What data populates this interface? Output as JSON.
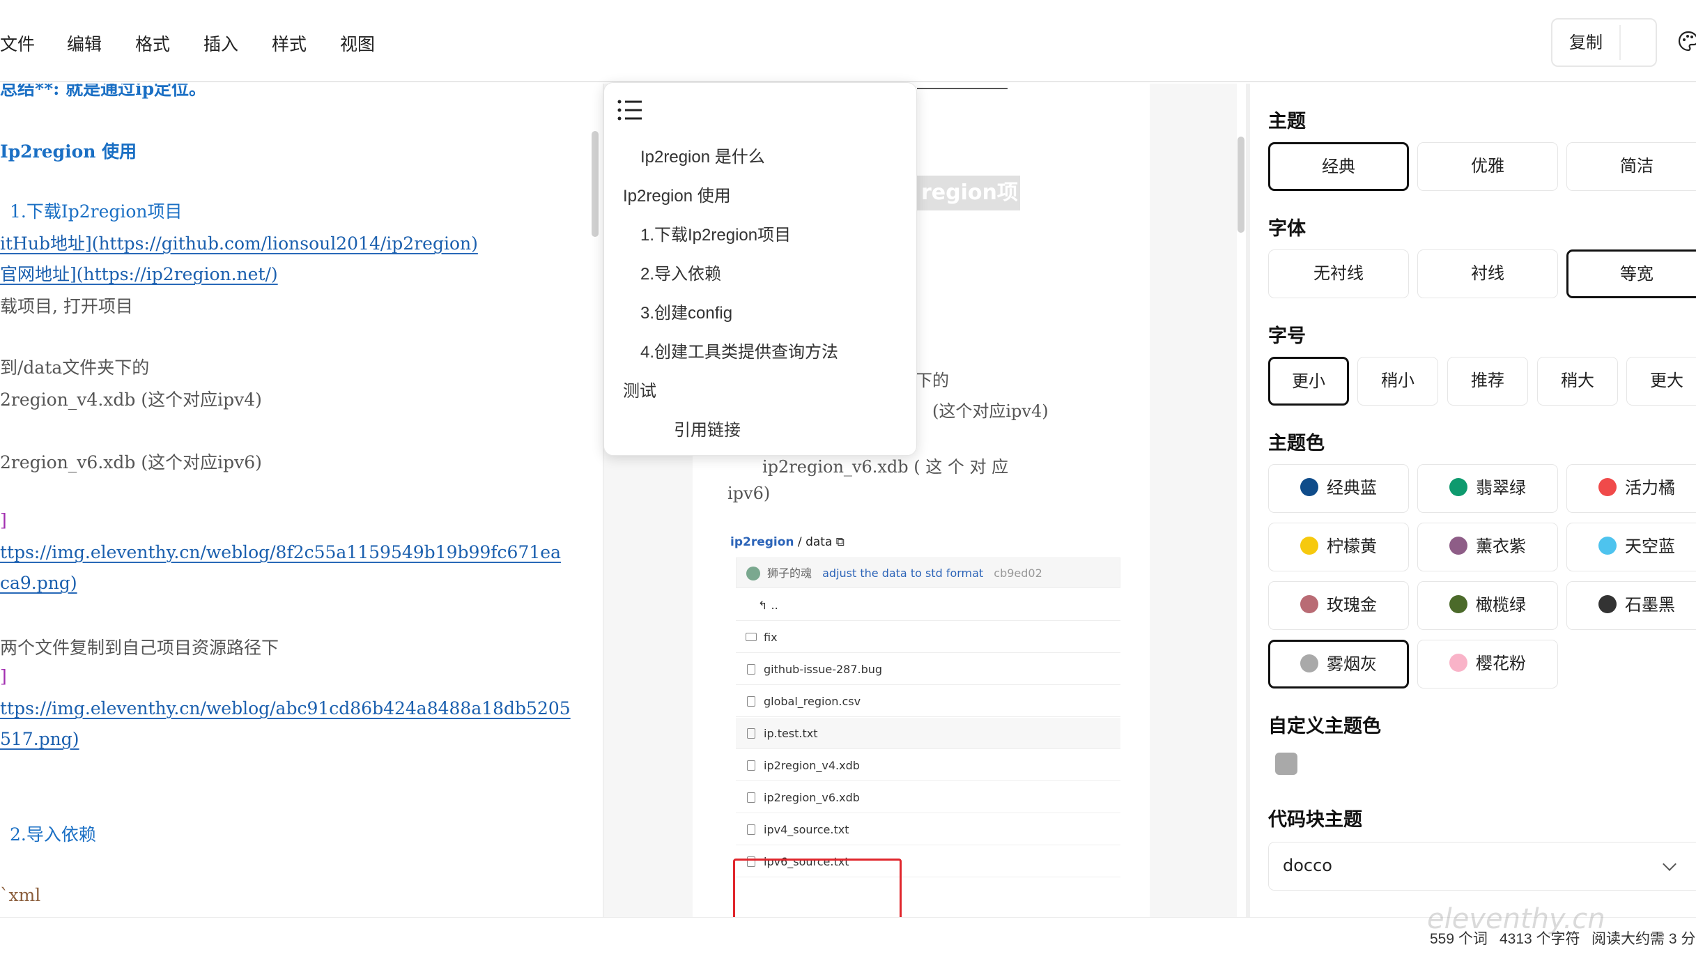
{
  "menu": {
    "items": [
      "文件",
      "编辑",
      "格式",
      "插入",
      "样式",
      "视图"
    ]
  },
  "toolbar": {
    "copy_label": "复制"
  },
  "editor": {
    "lines": [
      "总结**: 就是通过ip定位。",
      "Ip2region 使用",
      "1.下载Ip2region项目",
      "itHub地址](https://github.com/lionsoul2014/ip2region)",
      "官网地址](https://ip2region.net/)",
      "载项目, 打开项目",
      "到/data文件夹下的",
      "2region_v4.xdb  (这个对应ipv4)",
      "2region_v6.xdb  (这个对应ipv6)",
      "]",
      "ttps://img.eleventhy.cn/weblog/8f2c55a1159549b19b99fc671ea",
      "ca9.png)",
      "两个文件复制到自己项目资源路径下",
      "]",
      "ttps://img.eleventhy.cn/weblog/abc91cd86b424a8488a18db5205",
      "517.png)",
      "2.导入依赖",
      "`xml"
    ]
  },
  "outline": {
    "items": [
      "Ip2region 是什么",
      "Ip2region 使用",
      "1.下载Ip2region项目",
      "2.导入依赖",
      "3.创建config",
      "4.创建工具类提供查询方法",
      "测试",
      "引用链接"
    ]
  },
  "preview": {
    "heading_fragment": "region项目",
    "lines": [
      "下的",
      "(这个对应ipv4)",
      "ip2region_v6.xdb  ( 这 个 对 应",
      "ipv6)"
    ],
    "screenshot": {
      "repo": "ip2region",
      "path": "data",
      "commit_author": "狮子的魂",
      "commit_message": "adjust the data to std format",
      "commit_sha": "cb9ed02",
      "parent": "..",
      "files": [
        "fix",
        "github-issue-287.bug",
        "global_region.csv",
        "ip.test.txt",
        "ip2region_v4.xdb",
        "ip2region_v6.xdb",
        "ipv4_source.txt",
        "ipv6_source.txt"
      ]
    }
  },
  "settings": {
    "theme": {
      "title": "主题",
      "options": [
        "经典",
        "优雅",
        "简洁"
      ],
      "selected": "经典"
    },
    "font": {
      "title": "字体",
      "options": [
        "无衬线",
        "衬线",
        "等宽"
      ],
      "selected": "等宽"
    },
    "size": {
      "title": "字号",
      "options": [
        "更小",
        "稍小",
        "推荐",
        "稍大",
        "更大"
      ],
      "selected": "更小"
    },
    "color": {
      "title": "主题色",
      "selected": "雾烟灰",
      "options": [
        {
          "label": "经典蓝",
          "color": "#0f4c8a"
        },
        {
          "label": "翡翠绿",
          "color": "#0e9a6e"
        },
        {
          "label": "活力橘",
          "color": "#f04a4a"
        },
        {
          "label": "柠檬黄",
          "color": "#f6c90e"
        },
        {
          "label": "薰衣紫",
          "color": "#8e5d87"
        },
        {
          "label": "天空蓝",
          "color": "#4ec3ee"
        },
        {
          "label": "玫瑰金",
          "color": "#b96b74"
        },
        {
          "label": "橄榄绿",
          "color": "#4b6a2a"
        },
        {
          "label": "石墨黑",
          "color": "#333333"
        },
        {
          "label": "雾烟灰",
          "color": "#a9a9a9"
        },
        {
          "label": "樱花粉",
          "color": "#f9b3c8"
        }
      ]
    },
    "custom_color": {
      "title": "自定义主题色",
      "value": "#a9a9a9"
    },
    "code_theme": {
      "title": "代码块主题",
      "value": "docco"
    }
  },
  "status": {
    "words": "559 个词",
    "chars": "4313 个字符",
    "read_time": "阅读大约需 3 分"
  },
  "watermark": "eleventhy.cn"
}
